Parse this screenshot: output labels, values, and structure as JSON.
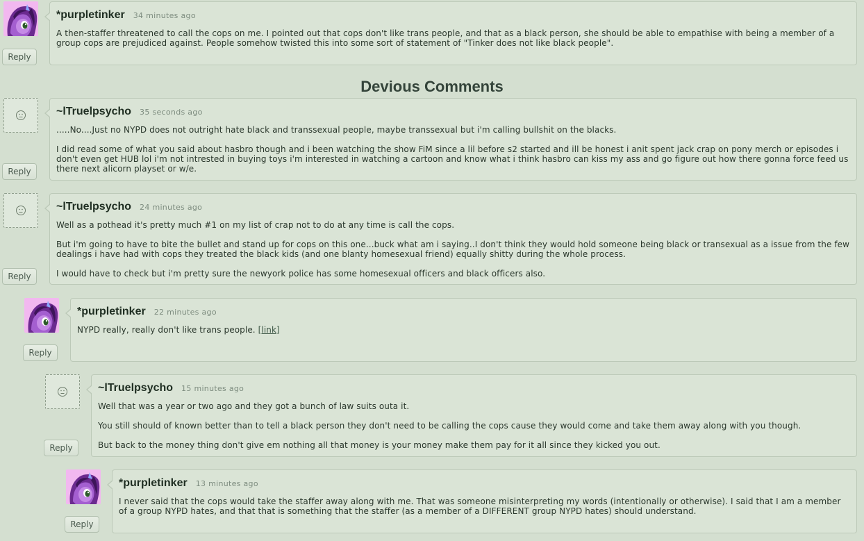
{
  "section_title": "Devious Comments",
  "reply_label": "Reply",
  "comments": [
    {
      "username": "*purpletinker",
      "timestamp": "34 minutes ago",
      "avatar": "pony-avatar",
      "paragraphs": [
        "A then-staffer threatened to call the cops on me. I pointed out that cops don't like trans people, and that as a black person, she should be able to empathise with being a member of a group cops are prejudiced against. People somehow twisted this into some sort of statement of \"Tinker does not like black people\"."
      ]
    },
    {
      "username": "~lTruelpsycho",
      "timestamp": "35 seconds ago",
      "avatar": "default-avatar",
      "paragraphs": [
        ".....No....Just no NYPD does not outright hate black and transsexual people, maybe transsexual but i'm calling bullshit on the blacks.",
        "I did read some of what you said about hasbro though and i been watching the show FiM since a lil before s2 started and ill be honest i anit spent jack crap on pony merch or episodes i don't even get HUB lol i'm not intrested in buying toys i'm interested in watching a cartoon and know what i think hasbro can kiss my ass and go figure out how there gonna force feed us there next alicorn playset or w/e."
      ]
    },
    {
      "username": "~lTruelpsycho",
      "timestamp": "24 minutes ago",
      "avatar": "default-avatar",
      "paragraphs": [
        "Well as a pothead it's pretty much #1 on my list of crap not to do at any time is call the cops.",
        "But i'm going to have to bite the bullet and stand up for cops on this one...buck what am i saying..I don't think they would hold someone being black or transexual as a issue from the few dealings i have had with cops they treated the black kids (and one blanty homesexual friend) equally shitty during the whole process.",
        "I would have to check but i'm pretty sure the newyork police has some homesexual officers and black officers also."
      ]
    },
    {
      "username": "*purpletinker",
      "timestamp": "22 minutes ago",
      "avatar": "pony-avatar",
      "paragraphs": [
        "NYPD really, really don't like trans people."
      ],
      "link_text": "[link]"
    },
    {
      "username": "~lTruelpsycho",
      "timestamp": "15 minutes ago",
      "avatar": "default-avatar",
      "paragraphs": [
        "Well that was a year or two ago and they got a bunch of law suits outa it.",
        "You still should of known better than to tell a black person they don't need to be calling the cops cause they would come and take them away along with you though.",
        "But back to the money thing don't give em nothing all that money is your money make them pay for it all since they kicked you out."
      ]
    },
    {
      "username": "*purpletinker",
      "timestamp": "13 minutes ago",
      "avatar": "pony-avatar",
      "paragraphs": [
        "I never said that the cops would take the staffer away along with me. That was someone misinterpreting my words (intentionally or otherwise). I said that I am a member of a group NYPD hates, and that that is something that the staffer (as a member of a DIFFERENT group NYPD hates) should understand."
      ]
    }
  ]
}
